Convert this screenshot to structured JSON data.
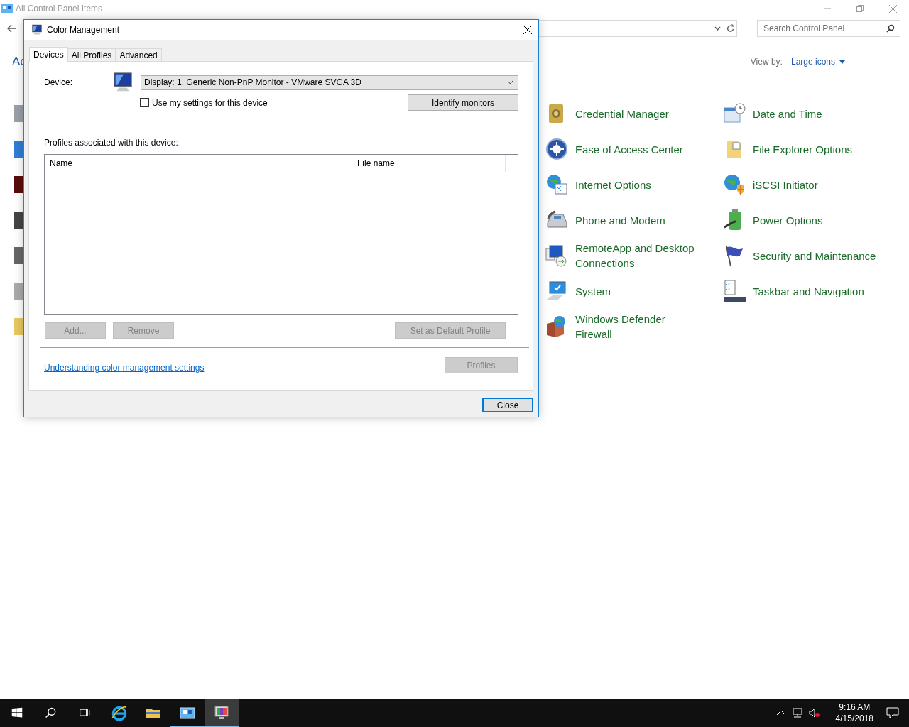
{
  "explorer": {
    "title": "All Control Panel Items",
    "search": {
      "placeholder": "Search Control Panel"
    },
    "heading": "Ac",
    "view_by": {
      "label": "View by:",
      "value": "Large icons"
    },
    "items": [
      {
        "label": "Credential Manager",
        "kind": "safe"
      },
      {
        "label": "Date and Time",
        "kind": "calendar"
      },
      {
        "label": "Ease of Access Center",
        "kind": "access"
      },
      {
        "label": "File Explorer Options",
        "kind": "folder"
      },
      {
        "label": "Internet Options",
        "kind": "globe-list"
      },
      {
        "label": "iSCSI Initiator",
        "kind": "globe-shield"
      },
      {
        "label": "Phone and Modem",
        "kind": "phone"
      },
      {
        "label": "Power Options",
        "kind": "battery"
      },
      {
        "label": "RemoteApp and Desktop Connections",
        "kind": "remote"
      },
      {
        "label": "Security and Maintenance",
        "kind": "flag"
      },
      {
        "label": "System",
        "kind": "computer"
      },
      {
        "label": "Taskbar and Navigation",
        "kind": "taskbar"
      },
      {
        "label": "Windows Defender Firewall",
        "kind": "firewall"
      }
    ]
  },
  "dialog": {
    "title": "Color Management",
    "tabs": [
      {
        "label": "Devices",
        "selected": true
      },
      {
        "label": "All Profiles",
        "selected": false
      },
      {
        "label": "Advanced",
        "selected": false
      }
    ],
    "device_label": "Device:",
    "device_value": "Display: 1. Generic Non-PnP Monitor - VMware SVGA 3D",
    "use_my_settings": {
      "label": "Use my settings for this device",
      "checked": false
    },
    "identify_button": {
      "label": "Identify monitors",
      "disabled": false
    },
    "profiles_label": "Profiles associated with this device:",
    "columns": [
      "Name",
      "File name"
    ],
    "buttons": [
      {
        "label": "Add...",
        "disabled": true
      },
      {
        "label": "Remove",
        "disabled": true
      },
      {
        "label": "Set as Default Profile",
        "disabled": true
      }
    ],
    "link": "Understanding color management settings",
    "profiles_button": {
      "label": "Profiles",
      "disabled": true
    },
    "close_button": {
      "label": "Close"
    }
  },
  "taskbar": {
    "apps": [
      {
        "kind": "start",
        "running": false,
        "selected": false
      },
      {
        "kind": "search",
        "running": false,
        "selected": false
      },
      {
        "kind": "task-view",
        "running": false,
        "selected": false
      },
      {
        "kind": "browser",
        "running": false,
        "selected": false
      },
      {
        "kind": "folder",
        "running": false,
        "selected": false
      },
      {
        "kind": "control-panel",
        "running": true,
        "selected": false
      },
      {
        "kind": "color-management",
        "running": true,
        "selected": true
      }
    ],
    "time": "9:16 AM",
    "date": "4/15/2018"
  }
}
